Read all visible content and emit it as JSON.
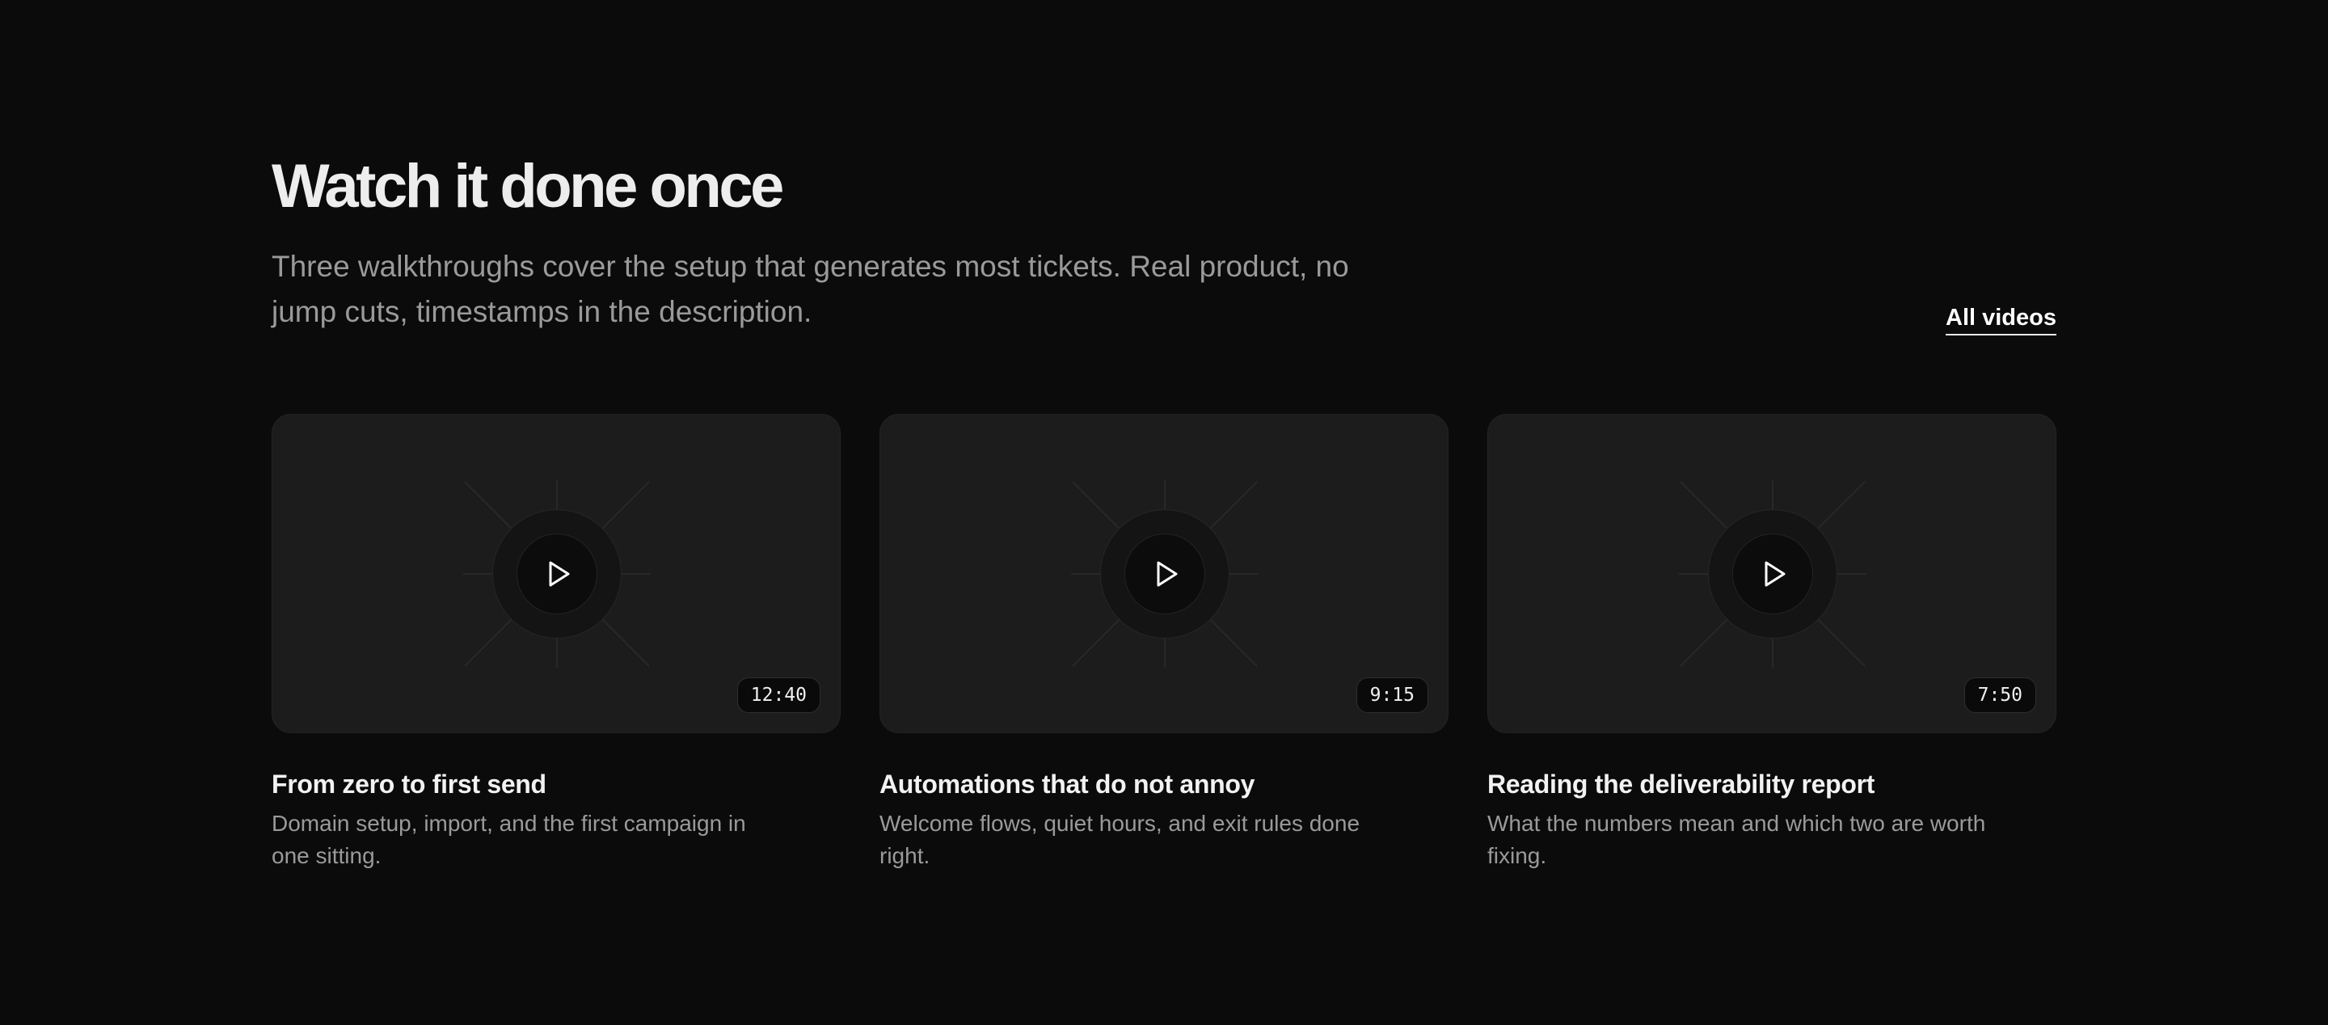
{
  "header": {
    "title": "Watch it done once",
    "subtitle": "Three walkthroughs cover the setup that generates most tickets. Real product, no jump cuts, timestamps in the description.",
    "all_videos_label": "All videos"
  },
  "videos": [
    {
      "title": "From zero to first send",
      "description": "Domain setup, import, and the first campaign in one sitting.",
      "duration": "12:40",
      "icon": "play-icon"
    },
    {
      "title": "Automations that do not annoy",
      "description": "Welcome flows, quiet hours, and exit rules done right.",
      "duration": "9:15",
      "icon": "play-icon"
    },
    {
      "title": "Reading the deliverability report",
      "description": "What the numbers mean and which two are worth fixing.",
      "duration": "7:50",
      "icon": "play-icon"
    }
  ],
  "colors": {
    "background": "#0b0b0b",
    "card": "#1c1c1c",
    "text": "#ededed",
    "muted": "#9a9a9a"
  }
}
